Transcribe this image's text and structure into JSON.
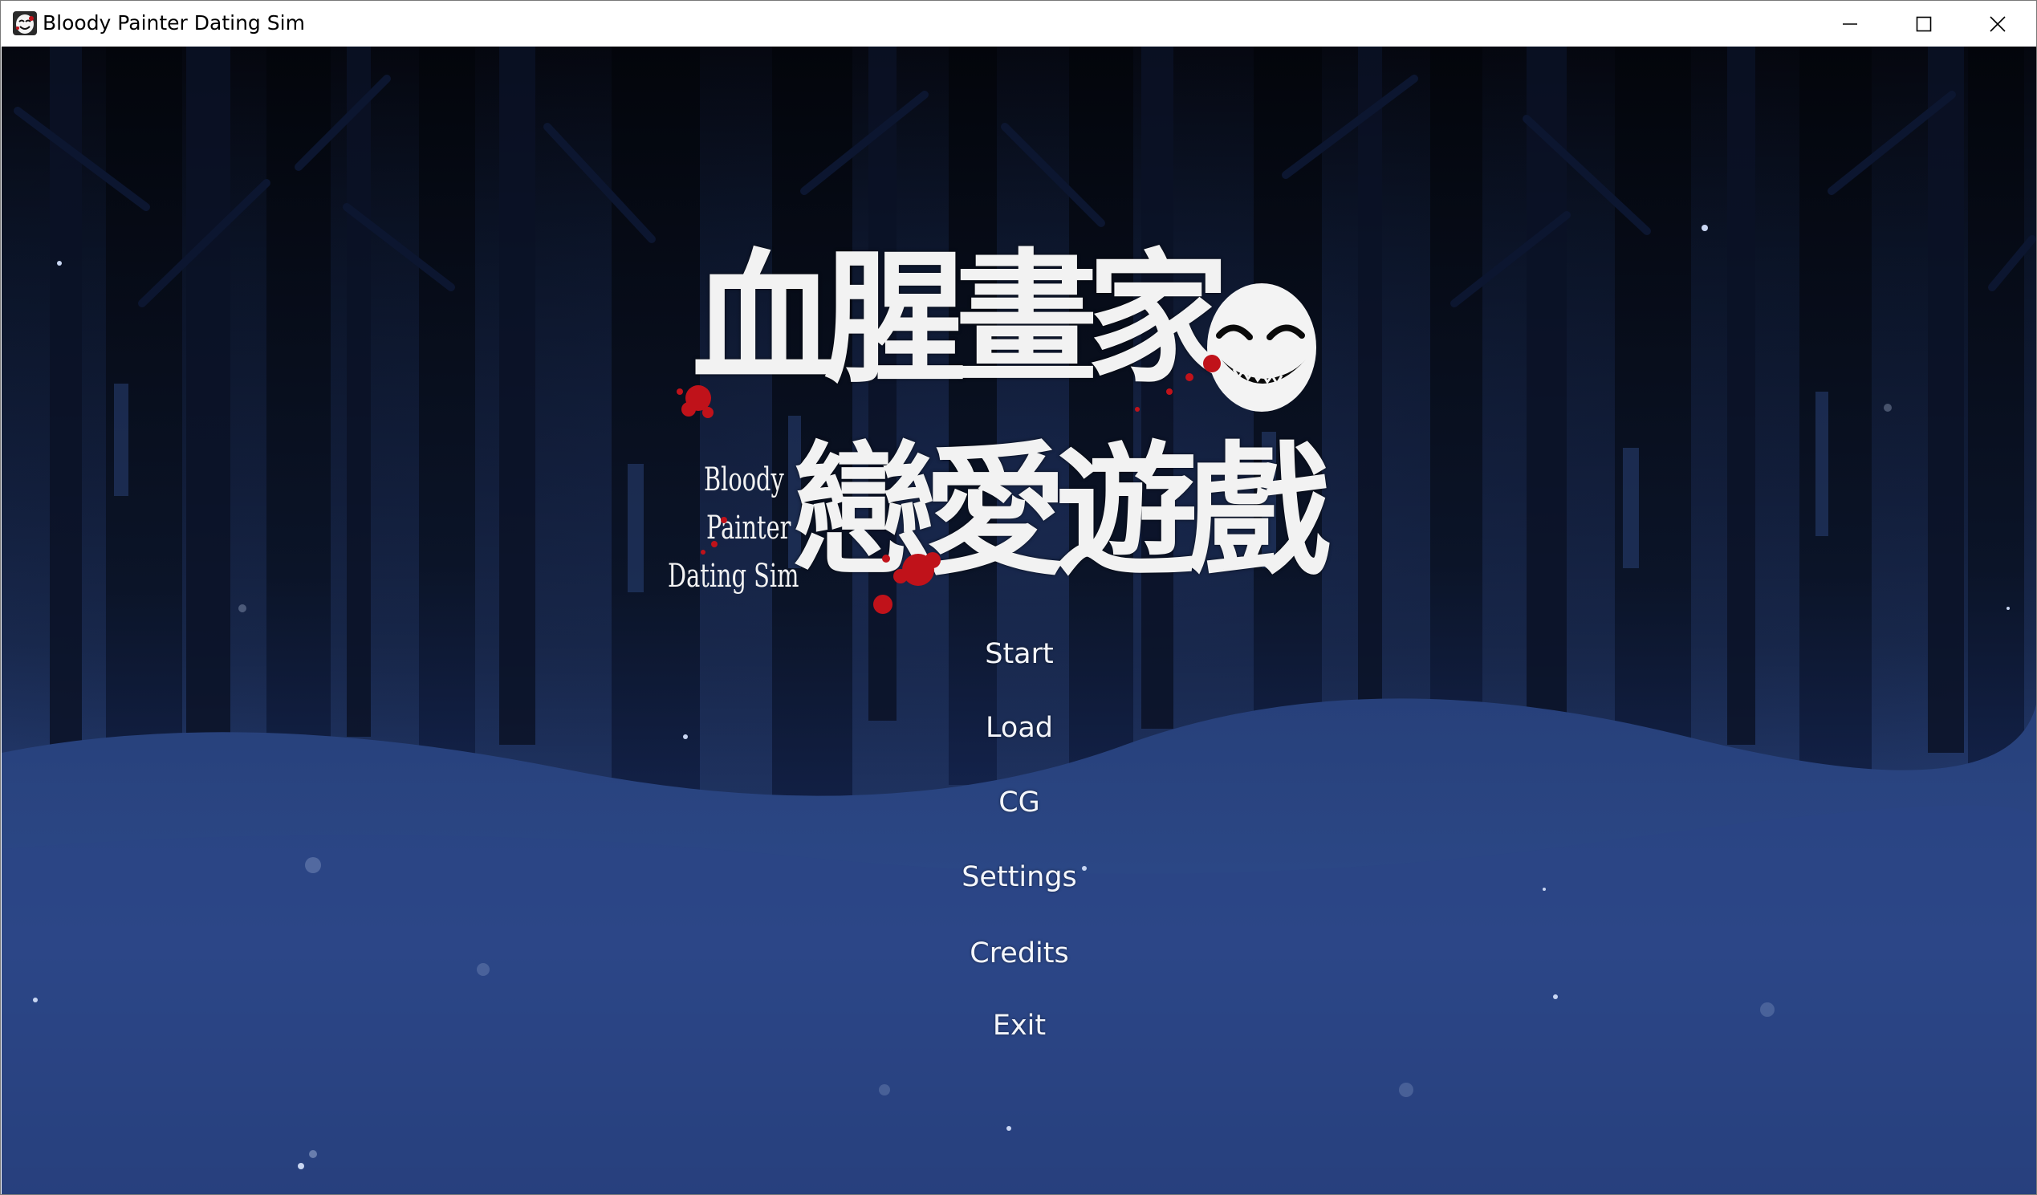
{
  "window": {
    "title": "Bloody Painter Dating Sim",
    "icon": "mask-app-icon",
    "controls": [
      "minimize-icon",
      "maximize-icon",
      "close-icon"
    ]
  },
  "logo": {
    "kanji_line_1": "血腥畫家",
    "kanji_line_2": "戀愛遊戲",
    "english_line_1": "Bloody",
    "english_line_2": "Painter",
    "english_line_3": "Dating Sim",
    "emblem": "smiling-mask-icon",
    "accent_color": "#c0121a"
  },
  "menu": {
    "items": [
      {
        "label": "Start"
      },
      {
        "label": "Load"
      },
      {
        "label": "CG"
      },
      {
        "label": "Settings"
      },
      {
        "label": "Credits"
      },
      {
        "label": "Exit"
      }
    ]
  },
  "background": {
    "scene": "snowy night forest",
    "sky_color": "#05070f",
    "snow_color": "#2c4785"
  }
}
